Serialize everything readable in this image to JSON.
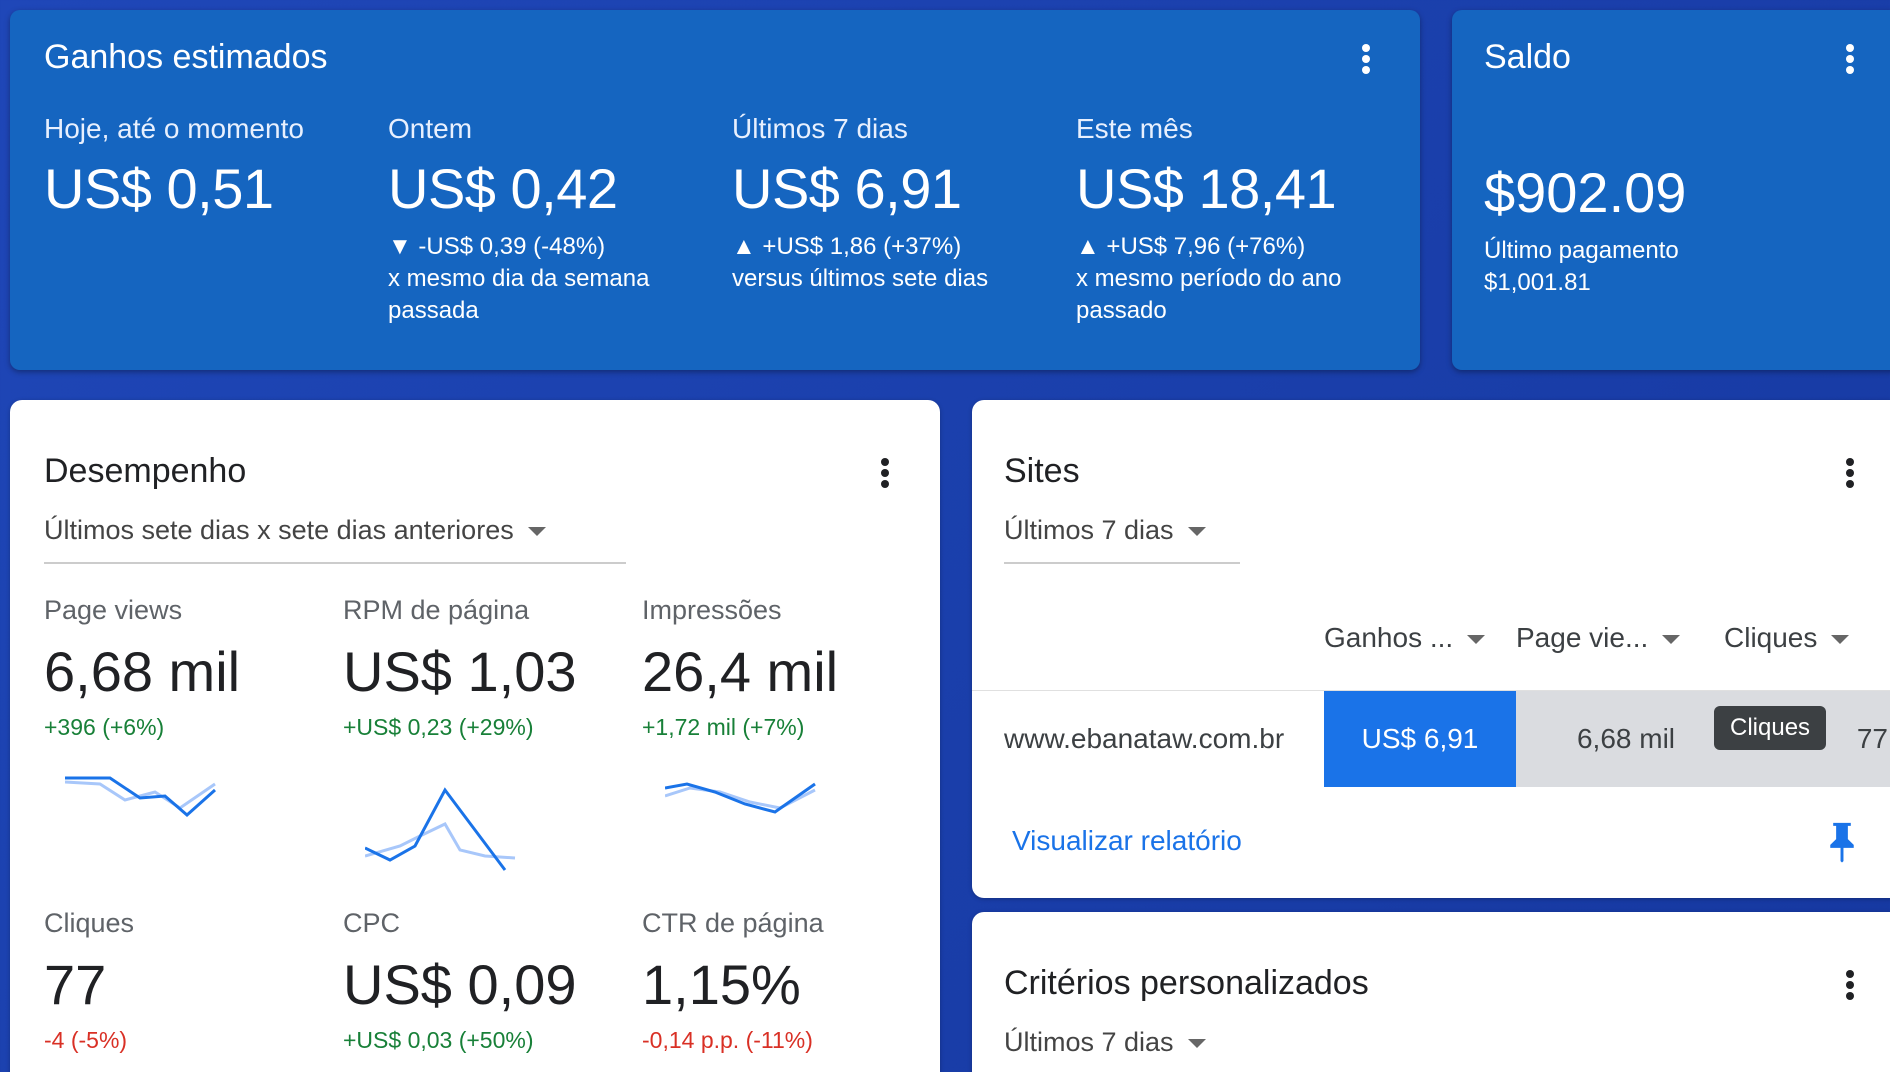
{
  "earnings": {
    "title": "Ganhos estimados",
    "periods": [
      {
        "label": "Hoje, até o momento",
        "value": "US$ 0,51",
        "delta": "",
        "compare": ""
      },
      {
        "label": "Ontem",
        "value": "US$ 0,42",
        "delta": "▼ -US$ 0,39 (-48%)",
        "compare": "x mesmo dia da semana passada"
      },
      {
        "label": "Últimos 7 dias",
        "value": "US$ 6,91",
        "delta": "▲ +US$ 1,86 (+37%)",
        "compare": "versus últimos sete dias"
      },
      {
        "label": "Este mês",
        "value": "US$ 18,41",
        "delta": "▲ +US$ 7,96 (+76%)",
        "compare": "x mesmo período do ano passado"
      }
    ]
  },
  "balance": {
    "title": "Saldo",
    "value": "$902.09",
    "last_payment_label": "Último pagamento",
    "last_payment_value": "$1,001.81"
  },
  "performance": {
    "title": "Desempenho",
    "range": "Últimos sete dias x sete dias anteriores",
    "metrics": [
      {
        "label": "Page views",
        "value": "6,68 mil",
        "delta": "+396 (+6%)",
        "trend": "positive"
      },
      {
        "label": "RPM de página",
        "value": "US$ 1,03",
        "delta": "+US$ 0,23 (+29%)",
        "trend": "positive"
      },
      {
        "label": "Impressões",
        "value": "26,4 mil",
        "delta": "+1,72 mil (+7%)",
        "trend": "positive"
      },
      {
        "label": "Cliques",
        "value": "77",
        "delta": "-4 (-5%)",
        "trend": "negative"
      },
      {
        "label": "CPC",
        "value": "US$ 0,09",
        "delta": "+US$ 0,03 (+50%)",
        "trend": "positive"
      },
      {
        "label": "CTR de página",
        "value": "1,15%",
        "delta": "-0,14 p.p. (-11%)",
        "trend": "negative"
      }
    ]
  },
  "sites": {
    "title": "Sites",
    "range": "Últimos 7 dias",
    "columns": [
      "Ganhos ...",
      "Page vie...",
      "Cliques"
    ],
    "row": {
      "site": "www.ebanataw.com.br",
      "earnings": "US$ 6,91",
      "page_views": "6,68 mil",
      "clicks": "77"
    },
    "tooltip": "Cliques",
    "report_link": "Visualizar relatório"
  },
  "custom": {
    "title": "Critérios personalizados",
    "range": "Últimos 7 dias"
  },
  "colors": {
    "card_blue": "#1565c0",
    "highlight_blue": "#1a73e8",
    "positive": "#188038",
    "negative": "#d93025"
  }
}
